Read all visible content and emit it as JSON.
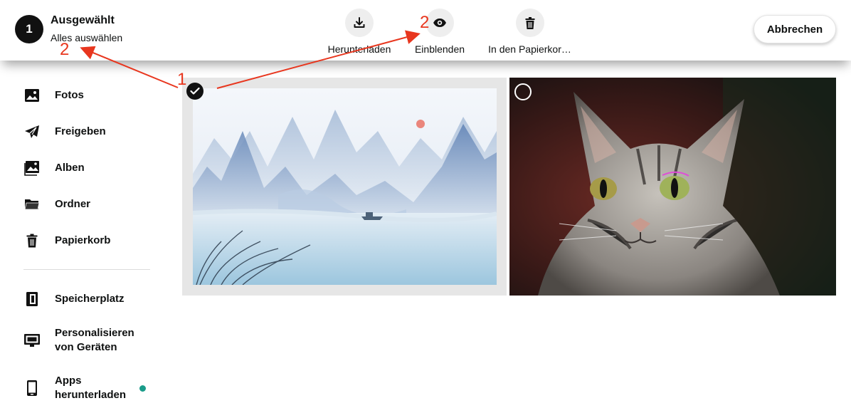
{
  "header": {
    "selected_count": "1",
    "title": "Ausgewählt",
    "select_all": "Alles auswählen",
    "actions": [
      {
        "label": "Herunterladen",
        "icon": "download-icon"
      },
      {
        "label": "Einblenden",
        "icon": "eye-icon"
      },
      {
        "label": "In den Papierkor…",
        "icon": "trash-icon"
      }
    ],
    "cancel_label": "Abbrechen"
  },
  "sidebar": {
    "items": [
      {
        "label": "Fotos",
        "icon": "image-icon"
      },
      {
        "label": "Freigeben",
        "icon": "paper-plane-icon"
      },
      {
        "label": "Alben",
        "icon": "album-icon"
      },
      {
        "label": "Ordner",
        "icon": "folder-icon"
      },
      {
        "label": "Papierkorb",
        "icon": "trash-icon"
      },
      {
        "label": "Speicherplatz",
        "icon": "storage-icon"
      },
      {
        "label": "Personalisieren\nvon Geräten",
        "icon": "monitor-icon"
      },
      {
        "label": "Apps\nherunterladen",
        "icon": "phone-icon"
      }
    ],
    "apps_dot_color": "#1a9c8a"
  },
  "photos": [
    {
      "subject": "ink-landscape",
      "selected": true
    },
    {
      "subject": "tabby-cat",
      "selected": false
    }
  ],
  "annotations": {
    "color": "#e8361e",
    "labels": [
      "2",
      "2",
      "1"
    ]
  }
}
